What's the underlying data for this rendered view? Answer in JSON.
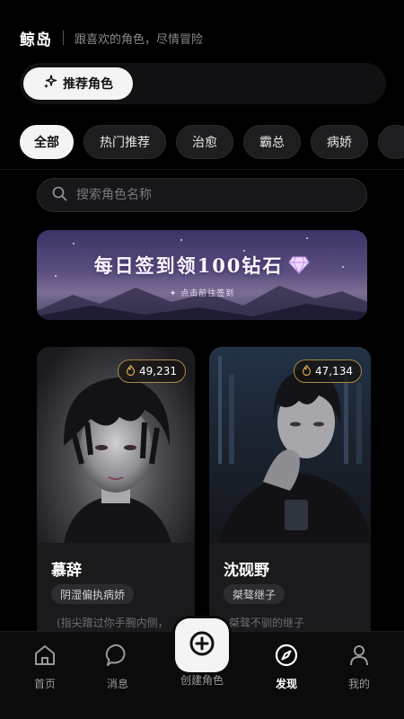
{
  "header": {
    "brand": "鲸岛",
    "slogan": "跟喜欢的角色，尽情冒险"
  },
  "recommend": {
    "button_label": "推荐角色"
  },
  "categories": [
    "全部",
    "热门推荐",
    "治愈",
    "霸总",
    "病娇"
  ],
  "search": {
    "placeholder": "搜索角色名称"
  },
  "banner": {
    "title": "每日签到领100钻石",
    "subtitle": "✦ 点击前往签到"
  },
  "cards": [
    {
      "heat": "49,231",
      "name": "慕辞",
      "tag": "阴湿偏执病娇",
      "desc": "(指尖蹭过你手腕内侧，"
    },
    {
      "heat": "47,134",
      "name": "沈砚野",
      "tag": "桀骜继子",
      "desc": "桀骜不驯的继子"
    }
  ],
  "nav": {
    "home": "首页",
    "messages": "消息",
    "create": "创建角色",
    "discover": "发现",
    "mine": "我的"
  },
  "colors": {
    "accent": "#f4f4f4",
    "background": "#000000",
    "heat_border": "#a88a45"
  }
}
